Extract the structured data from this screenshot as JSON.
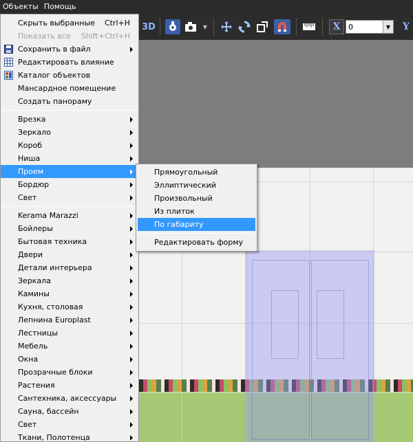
{
  "menubar": {
    "items": [
      "Объекты",
      "Помощь"
    ]
  },
  "toolbar": {
    "view_3d_label": "3D",
    "x_label": "X",
    "x_value": "0",
    "y_label": "Y"
  },
  "menu": {
    "top_items": [
      {
        "label": "Скрыть выбранные",
        "shortcut": "Ctrl+H"
      },
      {
        "label": "Показать все",
        "shortcut": "Shift+Ctrl+H"
      },
      {
        "label": "Сохранить в файл"
      },
      {
        "label": "Редактировать влияние"
      },
      {
        "label": "Каталог объектов"
      },
      {
        "label": "Мансардное помещение"
      },
      {
        "label": "Создать панораму"
      }
    ],
    "construct_items": [
      "Врезка",
      "Зеркало",
      "Короб",
      "Ниша",
      "Проем",
      "Бордюр",
      "Свет"
    ],
    "catalog_items": [
      "Kerama Marazzi",
      "Бойлеры",
      "Бытовая техника",
      "Двери",
      "Детали интерьера",
      "Зеркала",
      "Камины",
      "Кухня, столовая",
      "Лепнина Europlast",
      "Лестницы",
      "Мебель",
      "Окна",
      "Прозрачные блоки",
      "Растения",
      "Сантехника, аксессуары",
      "Сауна, бассейн",
      "Свет",
      "Ткани, Полотенца"
    ]
  },
  "submenu": {
    "items": [
      "Прямоугольный",
      "Эллиптический",
      "Произвольный",
      "Из плиток",
      "По габариту"
    ],
    "edit_item": "Редактировать форму"
  },
  "colors": {
    "highlight": "#3399ff",
    "toolbar_bg": "#2c2c2c",
    "door_overlay": "#9696f5"
  }
}
